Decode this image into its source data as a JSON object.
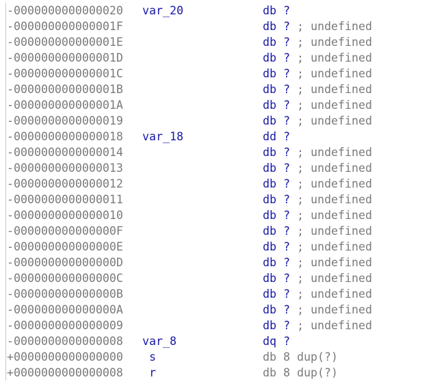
{
  "stack_frame": {
    "rows": [
      {
        "offset": "-0000000000000020",
        "name": "var_20",
        "directive": "db",
        "operand": "?",
        "comment": ""
      },
      {
        "offset": "-000000000000001F",
        "name": "",
        "directive": "db",
        "operand": "?",
        "comment": "; undefined"
      },
      {
        "offset": "-000000000000001E",
        "name": "",
        "directive": "db",
        "operand": "?",
        "comment": "; undefined"
      },
      {
        "offset": "-000000000000001D",
        "name": "",
        "directive": "db",
        "operand": "?",
        "comment": "; undefined"
      },
      {
        "offset": "-000000000000001C",
        "name": "",
        "directive": "db",
        "operand": "?",
        "comment": "; undefined"
      },
      {
        "offset": "-000000000000001B",
        "name": "",
        "directive": "db",
        "operand": "?",
        "comment": "; undefined"
      },
      {
        "offset": "-000000000000001A",
        "name": "",
        "directive": "db",
        "operand": "?",
        "comment": "; undefined"
      },
      {
        "offset": "-0000000000000019",
        "name": "",
        "directive": "db",
        "operand": "?",
        "comment": "; undefined"
      },
      {
        "offset": "-0000000000000018",
        "name": "var_18",
        "directive": "dd",
        "operand": "?",
        "comment": ""
      },
      {
        "offset": "-0000000000000014",
        "name": "",
        "directive": "db",
        "operand": "?",
        "comment": "; undefined"
      },
      {
        "offset": "-0000000000000013",
        "name": "",
        "directive": "db",
        "operand": "?",
        "comment": "; undefined"
      },
      {
        "offset": "-0000000000000012",
        "name": "",
        "directive": "db",
        "operand": "?",
        "comment": "; undefined"
      },
      {
        "offset": "-0000000000000011",
        "name": "",
        "directive": "db",
        "operand": "?",
        "comment": "; undefined"
      },
      {
        "offset": "-0000000000000010",
        "name": "",
        "directive": "db",
        "operand": "?",
        "comment": "; undefined"
      },
      {
        "offset": "-000000000000000F",
        "name": "",
        "directive": "db",
        "operand": "?",
        "comment": "; undefined"
      },
      {
        "offset": "-000000000000000E",
        "name": "",
        "directive": "db",
        "operand": "?",
        "comment": "; undefined"
      },
      {
        "offset": "-000000000000000D",
        "name": "",
        "directive": "db",
        "operand": "?",
        "comment": "; undefined"
      },
      {
        "offset": "-000000000000000C",
        "name": "",
        "directive": "db",
        "operand": "?",
        "comment": "; undefined"
      },
      {
        "offset": "-000000000000000B",
        "name": "",
        "directive": "db",
        "operand": "?",
        "comment": "; undefined"
      },
      {
        "offset": "-000000000000000A",
        "name": "",
        "directive": "db",
        "operand": "?",
        "comment": "; undefined"
      },
      {
        "offset": "-0000000000000009",
        "name": "",
        "directive": "db",
        "operand": "?",
        "comment": "; undefined"
      },
      {
        "offset": "-0000000000000008",
        "name": "var_8",
        "directive": "dq",
        "operand": "?",
        "comment": ""
      },
      {
        "offset": "+0000000000000000",
        "name": "s",
        "directive": "db 8 dup(?)",
        "operand": "",
        "comment": ""
      },
      {
        "offset": "+0000000000000008",
        "name": "r",
        "directive": "db 8 dup(?)",
        "operand": "",
        "comment": ""
      }
    ]
  },
  "colors": {
    "offset_text": "#7a7a7a",
    "name_text": "#1818a8",
    "directive_text": "#1818a8",
    "comment_text": "#7a7a7a",
    "background": "#ffffff"
  }
}
